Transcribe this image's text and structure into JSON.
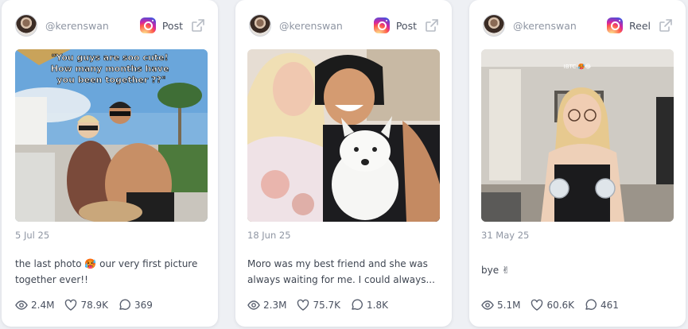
{
  "cards": [
    {
      "handle": "@kerenswan",
      "post_type": "Post",
      "date": "5 Jul 25",
      "caption": "the last photo 🥵 our very first picture together ever!!",
      "overlay_text": "\"You guys are soo cute! How many months have you been together ??\"",
      "views": "2.4M",
      "likes": "78.9K",
      "comments": "369"
    },
    {
      "handle": "@kerenswan",
      "post_type": "Post",
      "date": "18 Jun 25",
      "caption": "Moro was my best friend and she was always waiting for me. I could always...",
      "views": "2.3M",
      "likes": "75.7K",
      "comments": "1.8K"
    },
    {
      "handle": "@kerenswan",
      "post_type": "Reel",
      "date": "31 May 25",
      "caption": "bye ✌",
      "overlay_text": "IBTC🥵😂",
      "views": "5.1M",
      "likes": "60.6K",
      "comments": "461"
    }
  ],
  "icons": [
    "instagram-icon",
    "external-link-icon",
    "eye-icon",
    "heart-icon",
    "comment-icon"
  ]
}
